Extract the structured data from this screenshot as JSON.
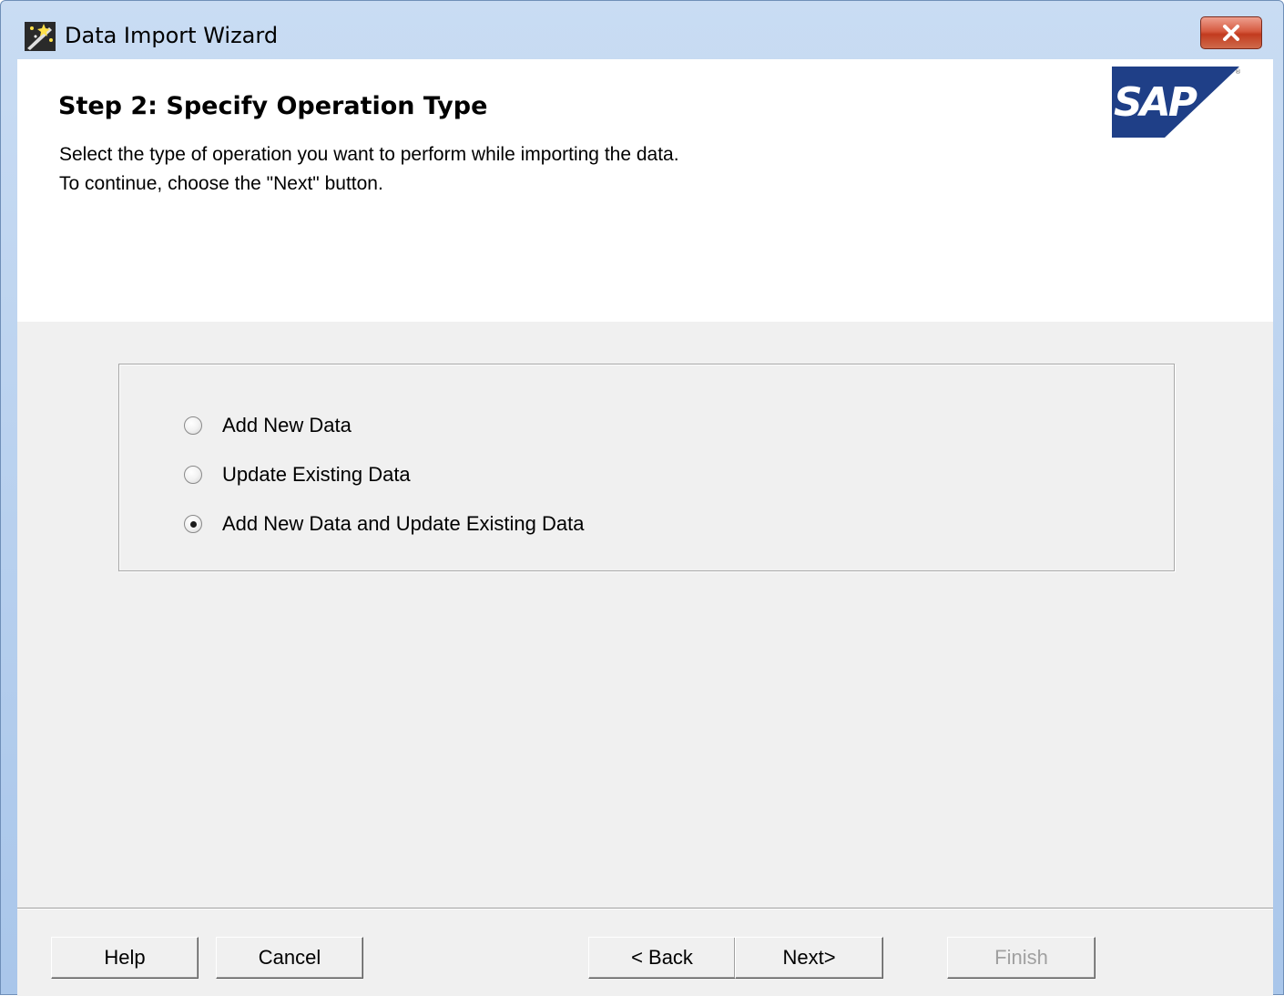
{
  "window": {
    "title": "Data Import Wizard",
    "app_icon": "wizard-wand-icon",
    "close_icon": "close-icon",
    "close_button_color": "#c94a2f"
  },
  "header": {
    "step_title": "Step 2: Specify Operation Type",
    "description_line1": "Select the type of operation you want to perform while importing the data.",
    "description_line2": "To continue, choose the \"Next\" button.",
    "logo_text": "SAP",
    "logo_color": "#1f3f87"
  },
  "options": [
    {
      "label": "Add New Data",
      "checked": false
    },
    {
      "label": "Update Existing Data",
      "checked": false
    },
    {
      "label": "Add New Data and Update Existing Data",
      "checked": true
    }
  ],
  "buttons": {
    "help": "Help",
    "cancel": "Cancel",
    "back": "< Back",
    "next": "Next>",
    "finish": "Finish",
    "finish_enabled": false
  }
}
